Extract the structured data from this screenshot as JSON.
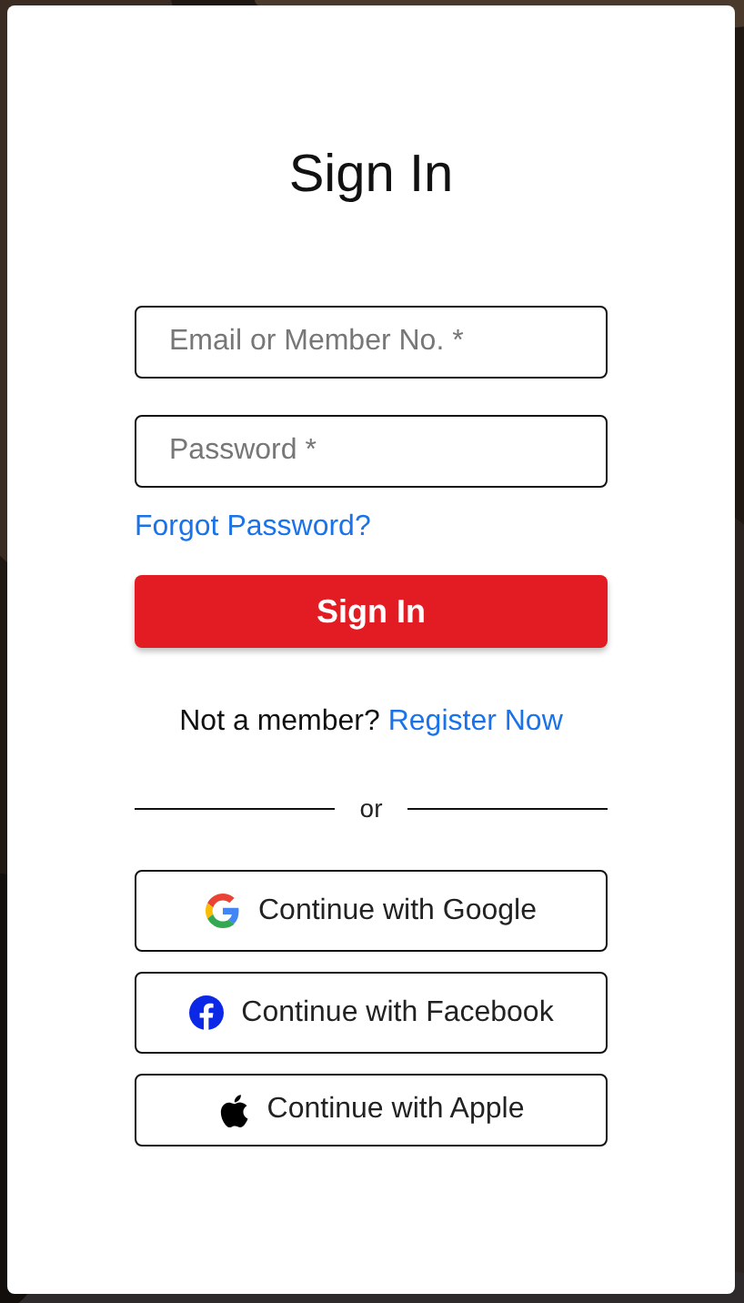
{
  "title": "Sign In",
  "fields": [
    {
      "placeholder": "Email or Member No. *"
    },
    {
      "placeholder": "Password *"
    }
  ],
  "forgot_link": "Forgot Password?",
  "submit_button": "Sign In",
  "register": {
    "prompt": "Not a member?",
    "link": "Register Now"
  },
  "divider_text": "or",
  "social_buttons": [
    {
      "kind": "google",
      "label": "Continue with Google"
    },
    {
      "kind": "facebook",
      "label": "Continue with Facebook"
    },
    {
      "kind": "apple",
      "label": "Continue with Apple"
    }
  ]
}
